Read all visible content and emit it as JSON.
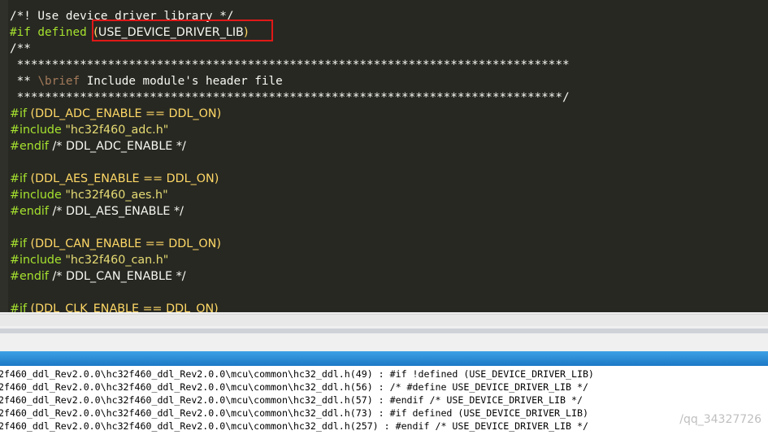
{
  "editor": {
    "lines": [
      [
        {
          "t": "/*! Use device driver library */",
          "c": "c-comment",
          "f": "mono"
        }
      ],
      [
        {
          "t": "#if defined ",
          "c": "c-kw",
          "f": "mono"
        },
        {
          "t": "(",
          "c": "c-paren",
          "f": "sans"
        },
        {
          "t": "USE_DEVICE_DRIVER_LIB",
          "c": "c-white",
          "f": "sans"
        },
        {
          "t": ")",
          "c": "c-paren",
          "f": "sans"
        }
      ],
      [
        {
          "t": "/**",
          "c": "c-comment",
          "f": "mono"
        }
      ],
      [
        {
          "t": " *******************************************************************************",
          "c": "c-comment",
          "f": "mono"
        }
      ],
      [
        {
          "t": " ** ",
          "c": "c-comment",
          "f": "mono"
        },
        {
          "t": "\\brief",
          "c": "c-brief",
          "f": "mono"
        },
        {
          "t": " Include module's header file",
          "c": "c-comment",
          "f": "mono"
        }
      ],
      [
        {
          "t": " ******************************************************************************/",
          "c": "c-comment",
          "f": "mono"
        }
      ],
      [
        {
          "t": "#if ",
          "c": "c-kw",
          "f": "sans"
        },
        {
          "t": "(",
          "c": "c-paren",
          "f": "sans"
        },
        {
          "t": "DDL_ADC_ENABLE ",
          "c": "c-paren",
          "f": "sans"
        },
        {
          "t": "==",
          "c": "c-paren",
          "f": "sans"
        },
        {
          "t": " DDL_ON",
          "c": "c-paren",
          "f": "sans"
        },
        {
          "t": ")",
          "c": "c-paren",
          "f": "sans"
        }
      ],
      [
        {
          "t": "#include ",
          "c": "c-kw",
          "f": "sans"
        },
        {
          "t": "\"hc32f460_adc.h\"",
          "c": "c-str",
          "f": "sans"
        }
      ],
      [
        {
          "t": "#endif ",
          "c": "c-kw",
          "f": "sans"
        },
        {
          "t": "/* DDL_ADC_ENABLE */",
          "c": "c-white",
          "f": "sans"
        }
      ],
      [
        {
          "t": "",
          "c": "c-white",
          "f": "sans"
        }
      ],
      [
        {
          "t": "#if ",
          "c": "c-kw",
          "f": "sans"
        },
        {
          "t": "(",
          "c": "c-paren",
          "f": "sans"
        },
        {
          "t": "DDL_AES_ENABLE ",
          "c": "c-paren",
          "f": "sans"
        },
        {
          "t": "==",
          "c": "c-paren",
          "f": "sans"
        },
        {
          "t": " DDL_ON",
          "c": "c-paren",
          "f": "sans"
        },
        {
          "t": ")",
          "c": "c-paren",
          "f": "sans"
        }
      ],
      [
        {
          "t": "#include ",
          "c": "c-kw",
          "f": "sans"
        },
        {
          "t": "\"hc32f460_aes.h\"",
          "c": "c-str",
          "f": "sans"
        }
      ],
      [
        {
          "t": "#endif ",
          "c": "c-kw",
          "f": "sans"
        },
        {
          "t": "/* DDL_AES_ENABLE */",
          "c": "c-white",
          "f": "sans"
        }
      ],
      [
        {
          "t": "",
          "c": "c-white",
          "f": "sans"
        }
      ],
      [
        {
          "t": "#if ",
          "c": "c-kw",
          "f": "sans"
        },
        {
          "t": "(",
          "c": "c-paren",
          "f": "sans"
        },
        {
          "t": "DDL_CAN_ENABLE ",
          "c": "c-paren",
          "f": "sans"
        },
        {
          "t": "==",
          "c": "c-paren",
          "f": "sans"
        },
        {
          "t": " DDL_ON",
          "c": "c-paren",
          "f": "sans"
        },
        {
          "t": ")",
          "c": "c-paren",
          "f": "sans"
        }
      ],
      [
        {
          "t": "#include ",
          "c": "c-kw",
          "f": "sans"
        },
        {
          "t": "\"hc32f460_can.h\"",
          "c": "c-str",
          "f": "sans"
        }
      ],
      [
        {
          "t": "#endif ",
          "c": "c-kw",
          "f": "sans"
        },
        {
          "t": "/* DDL_CAN_ENABLE */",
          "c": "c-white",
          "f": "sans"
        }
      ],
      [
        {
          "t": "",
          "c": "c-white",
          "f": "sans"
        }
      ],
      [
        {
          "t": "#if ",
          "c": "c-kw",
          "f": "sans"
        },
        {
          "t": "(",
          "c": "c-paren",
          "f": "sans"
        },
        {
          "t": "DDL_CLK_ENABLE ",
          "c": "c-paren",
          "f": "sans"
        },
        {
          "t": "==",
          "c": "c-paren",
          "f": "sans"
        },
        {
          "t": " DDL_ON",
          "c": "c-paren",
          "f": "sans"
        },
        {
          "t": ")",
          "c": "c-paren",
          "f": "sans"
        }
      ]
    ]
  },
  "results": {
    "lines": [
      "2f460_ddl_Rev2.0.0\\hc32f460_ddl_Rev2.0.0\\mcu\\common\\hc32_ddl.h(49) : #if !defined (USE_DEVICE_DRIVER_LIB)",
      "2f460_ddl_Rev2.0.0\\hc32f460_ddl_Rev2.0.0\\mcu\\common\\hc32_ddl.h(56) : /* #define USE_DEVICE_DRIVER_LIB */",
      "2f460_ddl_Rev2.0.0\\hc32f460_ddl_Rev2.0.0\\mcu\\common\\hc32_ddl.h(57) : #endif /* USE_DEVICE_DRIVER_LIB */",
      "2f460_ddl_Rev2.0.0\\hc32f460_ddl_Rev2.0.0\\mcu\\common\\hc32_ddl.h(73) : #if defined (USE_DEVICE_DRIVER_LIB)",
      "2f460_ddl_Rev2.0.0\\hc32f460_ddl_Rev2.0.0\\mcu\\common\\hc32_ddl.h(257) : #endif /* USE_DEVICE_DRIVER_LIB */"
    ]
  },
  "watermark": "/qq_34327726",
  "colors": {
    "editor_bg": "#272822",
    "highlight_box": "#e01818",
    "titlebar": "#1b78c5"
  }
}
